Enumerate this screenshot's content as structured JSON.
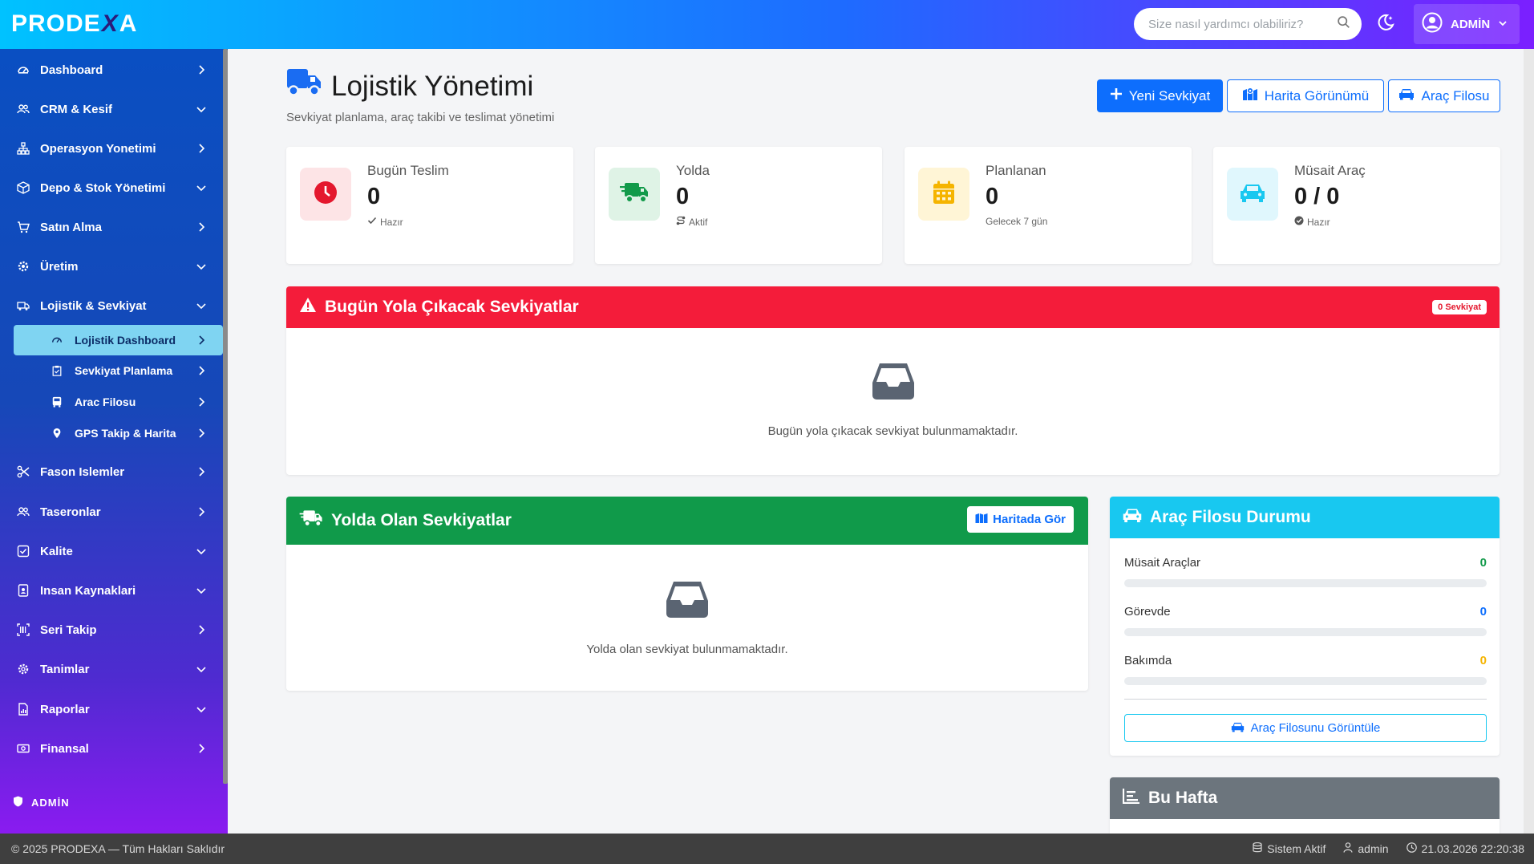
{
  "app": {
    "logo_main": "PRODE",
    "logo_x": "X",
    "logo_end": "A",
    "search_placeholder": "Size nasıl yardımcı olabiliriz?",
    "user_label": "ADMİN"
  },
  "sidebar": {
    "items": [
      {
        "label": "Dashboard",
        "icon": "gauge-icon"
      },
      {
        "label": "CRM & Kesif",
        "icon": "users-icon"
      },
      {
        "label": "Operasyon Yonetimi",
        "icon": "sitemap-icon"
      },
      {
        "label": "Depo & Stok Yönetimi",
        "icon": "box-icon"
      },
      {
        "label": "Satın Alma",
        "icon": "cart-icon"
      },
      {
        "label": "Üretim",
        "icon": "gear-icon"
      },
      {
        "label": "Lojistik & Sevkiyat",
        "icon": "truck-icon"
      },
      {
        "label": "Fason Islemler",
        "icon": "scissors-icon"
      },
      {
        "label": "Taseronlar",
        "icon": "users-icon"
      },
      {
        "label": "Kalite",
        "icon": "check-square-icon"
      },
      {
        "label": "Insan Kaynaklari",
        "icon": "id-badge-icon"
      },
      {
        "label": "Seri Takip",
        "icon": "barcode-icon"
      },
      {
        "label": "Tanimlar",
        "icon": "gear-icon"
      },
      {
        "label": "Raporlar",
        "icon": "file-chart-icon"
      },
      {
        "label": "Finansal",
        "icon": "money-icon"
      }
    ],
    "sub_items": [
      {
        "label": "Lojistik Dashboard",
        "icon": "gauge-icon"
      },
      {
        "label": "Sevkiyat Planlama",
        "icon": "clipboard-icon"
      },
      {
        "label": "Arac Filosu",
        "icon": "bus-icon"
      },
      {
        "label": "GPS Takip & Harita",
        "icon": "map-pin-icon"
      }
    ],
    "admin_label": "ADMİN"
  },
  "page": {
    "title": "Lojistik Yönetimi",
    "subtitle": "Sevkiyat planlama, araç takibi ve teslimat yönetimi",
    "buttons": {
      "new_shipment": "Yeni Sevkiyat",
      "map_view": "Harita Görünümü",
      "fleet": "Araç Filosu"
    }
  },
  "stats": [
    {
      "label": "Bugün Teslim",
      "value": "0",
      "note": "Hazır",
      "color": "#e4182e",
      "bg": "#fde4e6"
    },
    {
      "label": "Yolda",
      "value": "0",
      "note": "Aktif",
      "color": "#129a4a",
      "bg": "#dff3e6"
    },
    {
      "label": "Planlanan",
      "value": "0",
      "note": "Gelecek 7 gün",
      "color": "#f5b400",
      "bg": "#fff5d6"
    },
    {
      "label": "Müsait Araç",
      "value": "0 / 0",
      "note": "Hazır",
      "color": "#18c8f0",
      "bg": "#e0f7fd"
    }
  ],
  "today_panel": {
    "title": "Bugün Yola Çıkacak Sevkiyatlar",
    "badge": "0 Sevkiyat",
    "empty": "Bugün yola çıkacak sevkiyat bulunmamaktadır.",
    "color": "#f41c3a"
  },
  "onroad_panel": {
    "title": "Yolda Olan Sevkiyatlar",
    "button": "Haritada Gör",
    "empty": "Yolda olan sevkiyat bulunmamaktadır.",
    "color": "#109a4a"
  },
  "fleet_panel": {
    "title": "Araç Filosu Durumu",
    "color": "#18c8f0",
    "rows": [
      {
        "name": "Müsait Araçlar",
        "value": "0",
        "fraction": 0,
        "color": "#129a4a"
      },
      {
        "name": "Görevde",
        "value": "0",
        "fraction": 0,
        "color": "#0d6efd"
      },
      {
        "name": "Bakımda",
        "value": "0",
        "fraction": 0,
        "color": "#f5b400"
      }
    ],
    "button": "Araç Filosunu Görüntüle"
  },
  "week_panel": {
    "title": "Bu Hafta",
    "color": "#6c757d"
  },
  "footer": {
    "copyright": "© 2025 PRODEXA — Tüm Hakları Saklıdır",
    "status": "Sistem Aktif",
    "user": "admin",
    "datetime": "21.03.2026 22:20:38"
  }
}
